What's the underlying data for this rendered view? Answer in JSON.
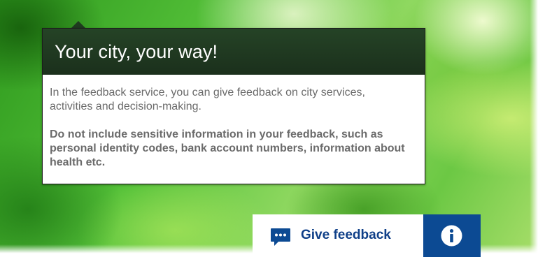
{
  "popup": {
    "title": "Your city, your way!",
    "description": "In the feedback service, you can give feedback on city services, activities and decision-making.",
    "warning": "Do not include sensitive information in your feedback, such as personal identity codes, bank account numbers, information about health etc."
  },
  "feedback_bar": {
    "give_feedback_label": "Give feedback",
    "feedback_icon": "chat-bubble-icon",
    "info_icon": "info-icon"
  },
  "colors": {
    "popup_header": "#1f3a20",
    "feedback_text": "#0f3f88",
    "info_button": "#0c4a93",
    "chat_icon": "#0c4a93"
  }
}
